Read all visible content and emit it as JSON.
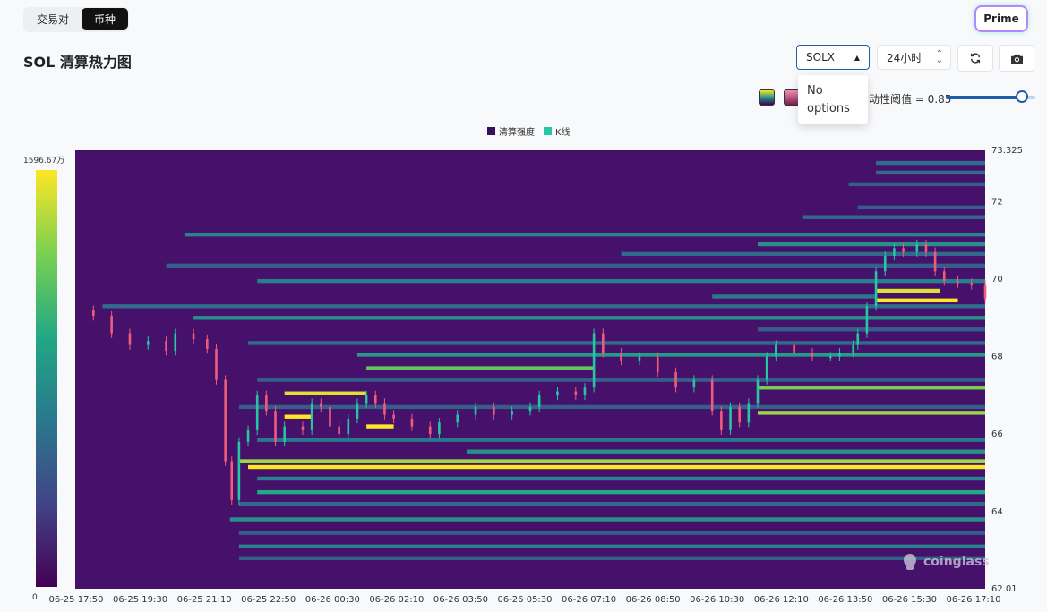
{
  "tabs": [
    {
      "label": "交易对",
      "active": false
    },
    {
      "label": "币种",
      "active": true
    }
  ],
  "prime_label": "Prime",
  "title": "SOL 清算热力图",
  "controls": {
    "exchange_select": "SOLX",
    "time_select": "24小时",
    "dropdown_message": "No options",
    "threshold_label": "动性阈值 = 0.85",
    "threshold_value": 0.85,
    "refresh_icon": "refresh-icon",
    "camera_icon": "camera-icon"
  },
  "colorbar": {
    "max_label": "1596.67万",
    "min_label": "0",
    "palette": [
      "#440154",
      "#414487",
      "#2a788e",
      "#22a884",
      "#7ad151",
      "#fde725"
    ]
  },
  "watermark": "coinglass",
  "chart_data": {
    "type": "heatmap",
    "legend": [
      {
        "name": "清算强度",
        "color": "#3a0f5a"
      },
      {
        "name": "K线",
        "color": "#26c6a0"
      }
    ],
    "y_axis": {
      "position": "right",
      "min": 62.01,
      "max": 73.325,
      "ticks": [
        "73.325",
        "72",
        "70",
        "68",
        "66",
        "64",
        "62.01"
      ]
    },
    "x_axis": {
      "ticks": [
        "06-25 17:50",
        "06-25 19:30",
        "06-25 21:10",
        "06-25 22:50",
        "06-26 00:30",
        "06-26 02:10",
        "06-26 03:50",
        "06-26 05:30",
        "06-26 07:10",
        "06-26 08:50",
        "06-26 10:30",
        "06-26 12:10",
        "06-26 13:50",
        "06-26 15:30",
        "06-26 17:10"
      ]
    },
    "background_color": "#46116b",
    "liquidation_bands": [
      {
        "price": 73.0,
        "start": 0.88,
        "end": 1.0,
        "intensity": 0.35
      },
      {
        "price": 72.75,
        "start": 0.88,
        "end": 1.0,
        "intensity": 0.35
      },
      {
        "price": 72.45,
        "start": 0.85,
        "end": 1.0,
        "intensity": 0.3
      },
      {
        "price": 71.85,
        "start": 0.86,
        "end": 1.0,
        "intensity": 0.3
      },
      {
        "price": 71.6,
        "start": 0.8,
        "end": 1.0,
        "intensity": 0.35
      },
      {
        "price": 71.15,
        "start": 0.12,
        "end": 1.0,
        "intensity": 0.45
      },
      {
        "price": 70.9,
        "start": 0.75,
        "end": 1.0,
        "intensity": 0.5
      },
      {
        "price": 70.65,
        "start": 0.6,
        "end": 1.0,
        "intensity": 0.35
      },
      {
        "price": 70.35,
        "start": 0.1,
        "end": 1.0,
        "intensity": 0.3
      },
      {
        "price": 69.95,
        "start": 0.2,
        "end": 1.0,
        "intensity": 0.42
      },
      {
        "price": 69.7,
        "start": 0.88,
        "end": 0.95,
        "intensity": 0.95
      },
      {
        "price": 69.45,
        "start": 0.88,
        "end": 0.97,
        "intensity": 1.0
      },
      {
        "price": 69.55,
        "start": 0.7,
        "end": 0.88,
        "intensity": 0.4
      },
      {
        "price": 69.3,
        "start": 0.03,
        "end": 1.0,
        "intensity": 0.35
      },
      {
        "price": 69.0,
        "start": 0.13,
        "end": 1.0,
        "intensity": 0.5
      },
      {
        "price": 68.7,
        "start": 0.75,
        "end": 1.0,
        "intensity": 0.3
      },
      {
        "price": 68.35,
        "start": 0.19,
        "end": 1.0,
        "intensity": 0.35
      },
      {
        "price": 68.05,
        "start": 0.31,
        "end": 1.0,
        "intensity": 0.55
      },
      {
        "price": 67.7,
        "start": 0.32,
        "end": 0.57,
        "intensity": 0.75
      },
      {
        "price": 67.4,
        "start": 0.2,
        "end": 1.0,
        "intensity": 0.3
      },
      {
        "price": 67.2,
        "start": 0.75,
        "end": 1.0,
        "intensity": 0.8
      },
      {
        "price": 67.05,
        "start": 0.23,
        "end": 0.32,
        "intensity": 0.95
      },
      {
        "price": 66.7,
        "start": 0.18,
        "end": 1.0,
        "intensity": 0.3
      },
      {
        "price": 66.55,
        "start": 0.75,
        "end": 1.0,
        "intensity": 0.85
      },
      {
        "price": 66.45,
        "start": 0.23,
        "end": 0.26,
        "intensity": 1.0
      },
      {
        "price": 66.2,
        "start": 0.32,
        "end": 0.35,
        "intensity": 1.0
      },
      {
        "price": 65.85,
        "start": 0.2,
        "end": 1.0,
        "intensity": 0.4
      },
      {
        "price": 65.55,
        "start": 0.43,
        "end": 1.0,
        "intensity": 0.5
      },
      {
        "price": 65.3,
        "start": 0.18,
        "end": 1.0,
        "intensity": 0.85
      },
      {
        "price": 65.15,
        "start": 0.19,
        "end": 1.0,
        "intensity": 1.0
      },
      {
        "price": 64.85,
        "start": 0.2,
        "end": 1.0,
        "intensity": 0.45
      },
      {
        "price": 64.5,
        "start": 0.2,
        "end": 1.0,
        "intensity": 0.6
      },
      {
        "price": 64.2,
        "start": 0.18,
        "end": 1.0,
        "intensity": 0.35
      },
      {
        "price": 63.8,
        "start": 0.17,
        "end": 1.0,
        "intensity": 0.5
      },
      {
        "price": 63.45,
        "start": 0.18,
        "end": 1.0,
        "intensity": 0.3
      },
      {
        "price": 63.1,
        "start": 0.18,
        "end": 1.0,
        "intensity": 0.45
      },
      {
        "price": 62.8,
        "start": 0.18,
        "end": 1.0,
        "intensity": 0.3
      }
    ],
    "kline_close": [
      {
        "t": 0.0,
        "p": 69.2
      },
      {
        "t": 0.02,
        "p": 69.05
      },
      {
        "t": 0.04,
        "p": 68.6
      },
      {
        "t": 0.06,
        "p": 68.3
      },
      {
        "t": 0.08,
        "p": 68.4
      },
      {
        "t": 0.1,
        "p": 68.15
      },
      {
        "t": 0.11,
        "p": 68.6
      },
      {
        "t": 0.13,
        "p": 68.45
      },
      {
        "t": 0.145,
        "p": 68.2
      },
      {
        "t": 0.155,
        "p": 67.4
      },
      {
        "t": 0.165,
        "p": 65.3
      },
      {
        "t": 0.172,
        "p": 64.3
      },
      {
        "t": 0.18,
        "p": 65.8
      },
      {
        "t": 0.19,
        "p": 66.1
      },
      {
        "t": 0.2,
        "p": 67.0
      },
      {
        "t": 0.21,
        "p": 66.6
      },
      {
        "t": 0.22,
        "p": 65.8
      },
      {
        "t": 0.23,
        "p": 66.2
      },
      {
        "t": 0.25,
        "p": 66.1
      },
      {
        "t": 0.26,
        "p": 66.8
      },
      {
        "t": 0.27,
        "p": 66.7
      },
      {
        "t": 0.28,
        "p": 66.2
      },
      {
        "t": 0.29,
        "p": 66.0
      },
      {
        "t": 0.3,
        "p": 66.4
      },
      {
        "t": 0.31,
        "p": 66.8
      },
      {
        "t": 0.32,
        "p": 67.0
      },
      {
        "t": 0.33,
        "p": 66.8
      },
      {
        "t": 0.34,
        "p": 66.5
      },
      {
        "t": 0.35,
        "p": 66.4
      },
      {
        "t": 0.37,
        "p": 66.2
      },
      {
        "t": 0.39,
        "p": 66.0
      },
      {
        "t": 0.4,
        "p": 66.3
      },
      {
        "t": 0.42,
        "p": 66.5
      },
      {
        "t": 0.44,
        "p": 66.7
      },
      {
        "t": 0.46,
        "p": 66.5
      },
      {
        "t": 0.48,
        "p": 66.6
      },
      {
        "t": 0.5,
        "p": 66.7
      },
      {
        "t": 0.51,
        "p": 67.0
      },
      {
        "t": 0.53,
        "p": 67.1
      },
      {
        "t": 0.55,
        "p": 67.0
      },
      {
        "t": 0.56,
        "p": 67.2
      },
      {
        "t": 0.57,
        "p": 68.6
      },
      {
        "t": 0.58,
        "p": 68.1
      },
      {
        "t": 0.6,
        "p": 67.9
      },
      {
        "t": 0.62,
        "p": 68.0
      },
      {
        "t": 0.64,
        "p": 67.6
      },
      {
        "t": 0.66,
        "p": 67.2
      },
      {
        "t": 0.68,
        "p": 67.4
      },
      {
        "t": 0.7,
        "p": 67.2
      },
      {
        "t": 0.7,
        "p": 66.6
      },
      {
        "t": 0.71,
        "p": 66.1
      },
      {
        "t": 0.72,
        "p": 66.7
      },
      {
        "t": 0.73,
        "p": 66.3
      },
      {
        "t": 0.74,
        "p": 66.8
      },
      {
        "t": 0.75,
        "p": 67.4
      },
      {
        "t": 0.76,
        "p": 68.0
      },
      {
        "t": 0.77,
        "p": 68.3
      },
      {
        "t": 0.79,
        "p": 68.1
      },
      {
        "t": 0.81,
        "p": 68.0
      },
      {
        "t": 0.83,
        "p": 68.0
      },
      {
        "t": 0.84,
        "p": 68.1
      },
      {
        "t": 0.855,
        "p": 68.3
      },
      {
        "t": 0.86,
        "p": 68.6
      },
      {
        "t": 0.87,
        "p": 69.3
      },
      {
        "t": 0.88,
        "p": 70.2
      },
      {
        "t": 0.89,
        "p": 70.6
      },
      {
        "t": 0.9,
        "p": 70.8
      },
      {
        "t": 0.91,
        "p": 70.7
      },
      {
        "t": 0.925,
        "p": 70.9
      },
      {
        "t": 0.935,
        "p": 70.7
      },
      {
        "t": 0.945,
        "p": 70.2
      },
      {
        "t": 0.955,
        "p": 69.95
      },
      {
        "t": 0.97,
        "p": 69.9
      },
      {
        "t": 0.985,
        "p": 69.85
      },
      {
        "t": 1.0,
        "p": 69.5
      }
    ]
  }
}
